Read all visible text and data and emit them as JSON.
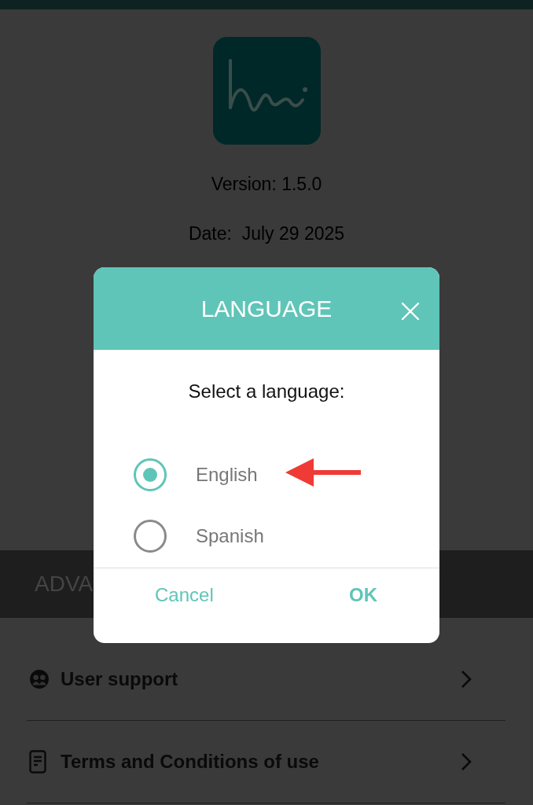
{
  "app": {
    "version": "Version: 1.5.0",
    "date": "Date:  July 29 2025"
  },
  "section_header": "ADVA",
  "menu": [
    {
      "label": "User support",
      "kind": "support"
    },
    {
      "label": "Terms and Conditions of use",
      "kind": "document"
    }
  ],
  "dialog": {
    "title": "LANGUAGE",
    "prompt": "Select a language:",
    "options": [
      {
        "label": "English",
        "selected": true
      },
      {
        "label": "Spanish",
        "selected": false
      }
    ],
    "buttons": [
      {
        "label": "Cancel",
        "kind": "cancel"
      },
      {
        "label": "OK",
        "kind": "confirm"
      }
    ]
  }
}
